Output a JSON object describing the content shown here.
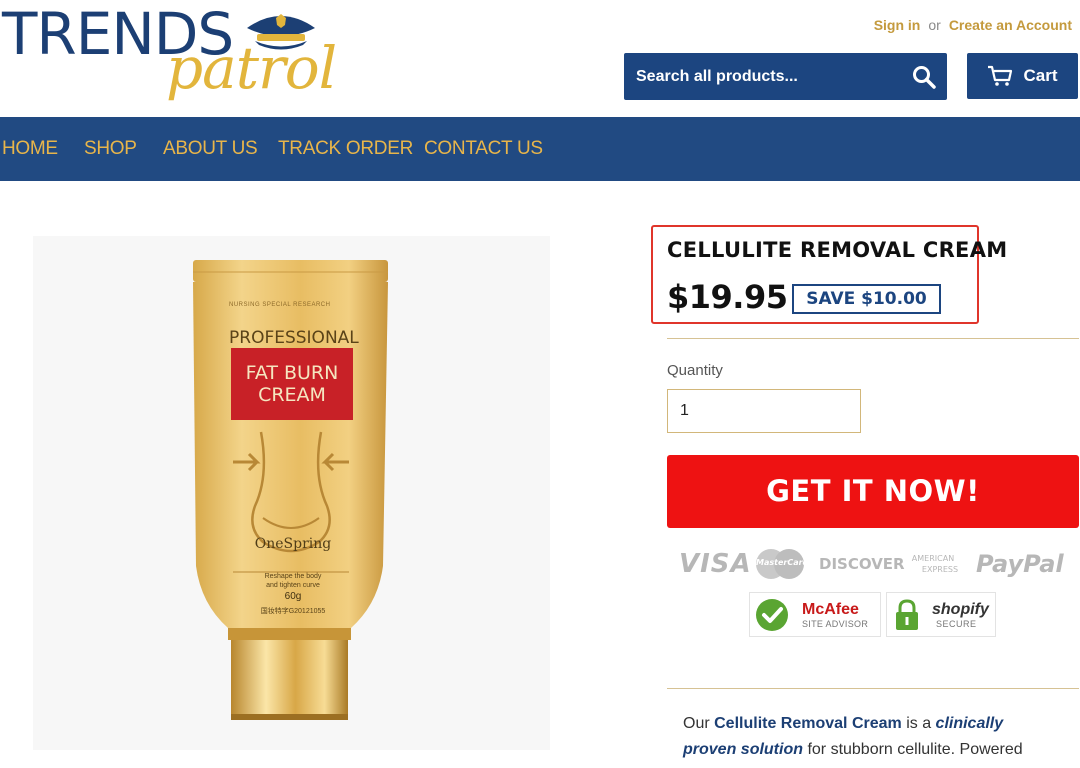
{
  "brand": {
    "logo_word_1": "TRENDS",
    "logo_word_2": "patrol",
    "primary_color": "#1c4580",
    "accent_color": "#e2b53c"
  },
  "header": {
    "sign_in": "Sign in",
    "or": "or",
    "create_account": "Create an Account",
    "search_placeholder": "Search all products...",
    "search_icon": "search-icon",
    "cart_label": "Cart",
    "cart_icon": "cart-icon"
  },
  "nav": {
    "items": [
      {
        "label": "HOME"
      },
      {
        "label": "SHOP"
      },
      {
        "label": "ABOUT US"
      },
      {
        "label": "TRACK ORDER"
      },
      {
        "label": "CONTACT US"
      }
    ]
  },
  "product": {
    "image": {
      "brand_text": "PROFESSIONAL",
      "label_line_1": "FAT BURN",
      "label_line_2": "CREAM",
      "maker": "OneSpring",
      "small_text_1": "Reshape the body",
      "small_text_2": "and tighten curve",
      "weight": "60g",
      "top_small": "NURSING SPECIAL RESEARCH",
      "code": "国妆特字G20121055"
    },
    "title": "CELLULITE REMOVAL CREAM",
    "price": "$19.95",
    "save": "SAVE $10.00",
    "quantity_label": "Quantity",
    "quantity_value": "1",
    "buy_button": "GET IT NOW!",
    "highlight_color": "#e0352b",
    "buy_color": "#ee1212"
  },
  "payments": {
    "visa": "VISA",
    "mastercard": "MasterCard",
    "discover": "DISCOVER",
    "amex_1": "AMERICAN",
    "amex_2": "EXPRESS",
    "paypal": "PayPal"
  },
  "trust": {
    "mcafee_title": "McAfee",
    "mcafee_sub": "SITE ADVISOR",
    "shopify_title": "shopify",
    "shopify_sub": "SECURE"
  },
  "description": {
    "p1": "Our ",
    "p2": "Cellulite Removal Cream",
    "p3": " is a ",
    "p4": "clinically",
    "p5": "proven solution",
    "p6": " for stubborn cellulite. Powered"
  }
}
